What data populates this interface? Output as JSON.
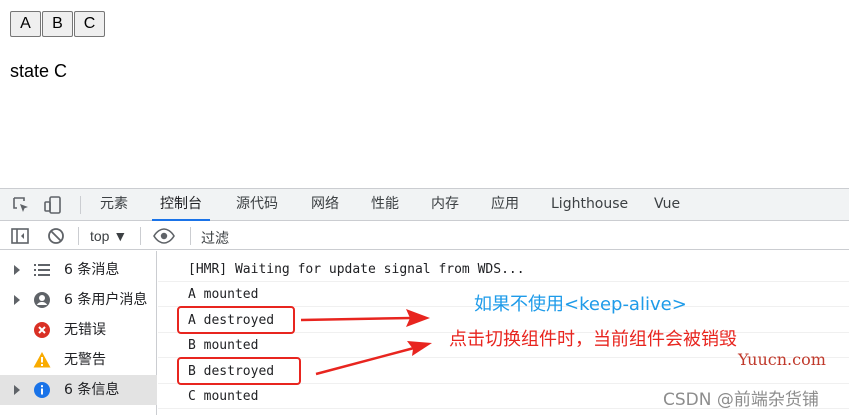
{
  "app": {
    "buttons": [
      "A",
      "B",
      "C"
    ],
    "state_text": "state C"
  },
  "devtools": {
    "tabs": [
      "元素",
      "控制台",
      "源代码",
      "网络",
      "性能",
      "内存",
      "应用",
      "Lighthouse",
      "Vue"
    ],
    "active_tab": "控制台",
    "toolbar": {
      "context_selector": "top ▼",
      "filter_placeholder": "过滤"
    },
    "sidebar": [
      {
        "label": "6 条消息",
        "icon": "list-icon",
        "expandable": true
      },
      {
        "label": "6 条用户消息",
        "icon": "user-icon",
        "expandable": true
      },
      {
        "label": "无错误",
        "icon": "error-icon",
        "expandable": false
      },
      {
        "label": "无警告",
        "icon": "warning-icon",
        "expandable": false
      },
      {
        "label": "6 条信息",
        "icon": "info-icon",
        "expandable": true,
        "selected": true
      }
    ],
    "console_lines": [
      "[HMR] Waiting for update signal from WDS...",
      "A mounted",
      "A destroyed",
      "B mounted",
      "B destroyed",
      "C mounted"
    ]
  },
  "annotations": {
    "blue_text": "如果不使用<keep-alive>",
    "red_text": "点击切换组件时，当前组件会被销毁",
    "watermark_site": "Yuucn.com",
    "watermark_csdn": "CSDN @前端杂货铺"
  },
  "colors": {
    "annotation_red": "#e8251f",
    "annotation_blue": "#1e9be9",
    "active_tab_underline": "#1a73e8"
  }
}
